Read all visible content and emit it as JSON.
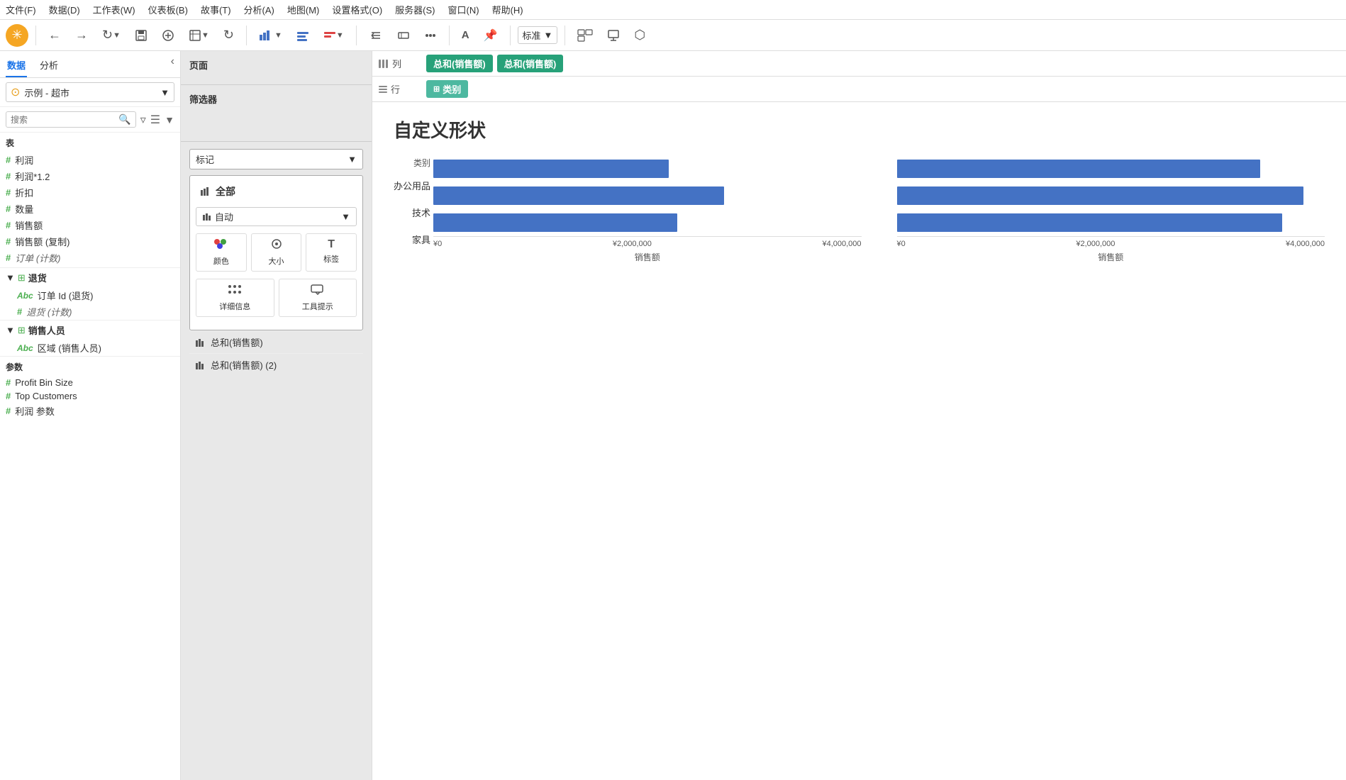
{
  "menu": {
    "items": [
      "文件(F)",
      "数据(D)",
      "工作表(W)",
      "仪表板(B)",
      "故事(T)",
      "分析(A)",
      "地图(M)",
      "设置格式(O)",
      "服务器(S)",
      "窗口(N)",
      "帮助(H)"
    ]
  },
  "toolbar": {
    "standard_label": "标准",
    "logo_symbol": "✳"
  },
  "left": {
    "tab_data": "数据",
    "tab_analysis": "分析",
    "datasource": "示例 - 超市",
    "search_placeholder": "搜索",
    "section_table": "表",
    "fields": [
      {
        "type": "hash",
        "name": "利润"
      },
      {
        "type": "hash",
        "name": "利润*1.2"
      },
      {
        "type": "hash",
        "name": "折扣"
      },
      {
        "type": "hash",
        "name": "数量"
      },
      {
        "type": "hash",
        "name": "销售额"
      },
      {
        "type": "hash",
        "name": "销售额 (复制)"
      },
      {
        "type": "hash",
        "name": "订单 (计数)",
        "italic": true
      }
    ],
    "groups": [
      {
        "name": "退货",
        "type": "group",
        "items": [
          {
            "type": "abc",
            "name": "订单 Id (退货)"
          },
          {
            "type": "hash",
            "name": "退货 (计数)",
            "italic": true
          }
        ]
      },
      {
        "name": "销售人员",
        "type": "group",
        "items": [
          {
            "type": "abc",
            "name": "区域 (销售人员)"
          }
        ]
      }
    ],
    "section_params": "参数",
    "params": [
      {
        "type": "hash",
        "name": "Profit Bin Size"
      },
      {
        "type": "hash",
        "name": "Top Customers"
      },
      {
        "type": "hash",
        "name": "利润 参数"
      }
    ]
  },
  "middle": {
    "page_section_label": "页面",
    "filter_section_label": "筛选器",
    "marks_section_label": "标记",
    "marks_all_label": "全部",
    "marks_type_label": "自动",
    "mark_buttons": [
      {
        "icon": "⬤⬤⬤",
        "label": "颜色"
      },
      {
        "icon": "◎",
        "label": "大小"
      },
      {
        "icon": "T",
        "label": "标签"
      }
    ],
    "mark_buttons2": [
      {
        "icon": "⬤⬤⬤\n⬤⬤⬤",
        "label": "详细信息"
      },
      {
        "icon": "💬",
        "label": "工具提示"
      }
    ],
    "sum_rows": [
      {
        "label": "总和(销售额)"
      },
      {
        "label": "总和(销售额) (2)"
      }
    ]
  },
  "shelf": {
    "col_label": "列",
    "col_icon": "⦿⦿⦿",
    "row_label": "行",
    "row_icon": "≡",
    "pills_col": [
      "总和(销售额)",
      "总和(销售额)"
    ],
    "pills_row": [
      "类别"
    ],
    "pills_row_icon": "⊞"
  },
  "chart": {
    "title": "自定义形状",
    "y_axis_label": "类别",
    "categories": [
      "办公用品",
      "技术",
      "家具"
    ],
    "bars_left": [
      {
        "label": "办公用品",
        "pct": 55
      },
      {
        "label": "技术",
        "pct": 68
      },
      {
        "label": "家具",
        "pct": 56
      }
    ],
    "bars_right": [
      {
        "label": "办公用品",
        "pct": 85
      },
      {
        "label": "技术",
        "pct": 95
      },
      {
        "label": "家具",
        "pct": 90
      }
    ],
    "x_ticks_left": [
      "¥0",
      "¥2,000,000",
      "¥4,000,000"
    ],
    "x_ticks_right": [
      "¥0",
      "¥2,000,000",
      "¥4,000,000"
    ],
    "x_label_left": "销售额",
    "x_label_right": "销售额",
    "bar_color": "#4472c4"
  }
}
